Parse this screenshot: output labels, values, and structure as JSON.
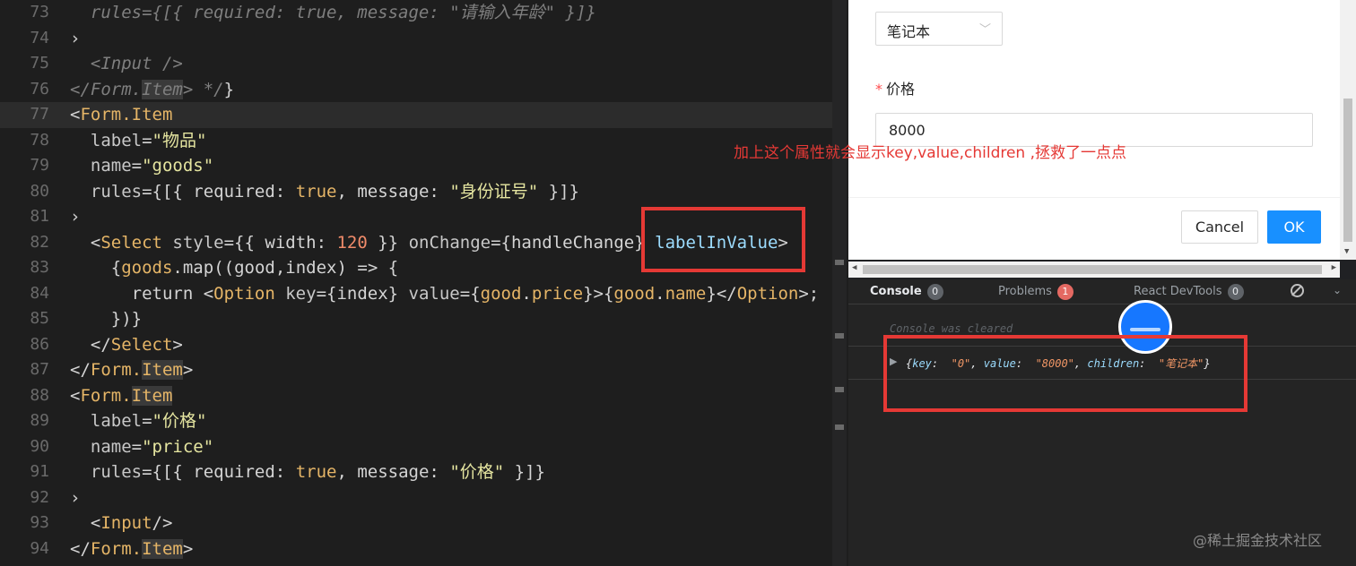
{
  "editor": {
    "lines": [
      {
        "n": "73",
        "segments": [
          [
            "  rules={[{ required: true, message: \"请输入年龄\" }]}",
            "comment"
          ]
        ]
      },
      {
        "n": "74",
        "segments": [
          [
            "›",
            "punct"
          ]
        ]
      },
      {
        "n": "75",
        "segments": [
          [
            "  <Input />",
            "comment"
          ]
        ]
      },
      {
        "n": "76",
        "segments": [
          [
            "</Form.",
            "comment"
          ],
          [
            "Item",
            "comment-hl"
          ],
          [
            "> */",
            "comment"
          ],
          [
            "}",
            "punct"
          ]
        ]
      },
      {
        "n": "77",
        "current": true,
        "segments": [
          [
            "<",
            "punct"
          ],
          [
            "Form.Item",
            "tag"
          ]
        ]
      },
      {
        "n": "78",
        "segments": [
          [
            "  label",
            "attr"
          ],
          [
            "=",
            "punct"
          ],
          [
            "\"物品\"",
            "str"
          ]
        ]
      },
      {
        "n": "79",
        "segments": [
          [
            "  name",
            "attr"
          ],
          [
            "=",
            "punct"
          ],
          [
            "\"goods\"",
            "str"
          ]
        ]
      },
      {
        "n": "80",
        "segments": [
          [
            "  rules",
            "attr"
          ],
          [
            "={[{ ",
            "punct"
          ],
          [
            "required",
            "prop"
          ],
          [
            ": ",
            "punct"
          ],
          [
            "true",
            "kw"
          ],
          [
            ", ",
            "punct"
          ],
          [
            "message",
            "prop"
          ],
          [
            ": ",
            "punct"
          ],
          [
            "\"身份证号\"",
            "str"
          ],
          [
            " }]}",
            "punct"
          ]
        ]
      },
      {
        "n": "81",
        "segments": [
          [
            "›",
            "punct"
          ]
        ]
      },
      {
        "n": "82",
        "segments": [
          [
            "  <",
            "punct"
          ],
          [
            "Select",
            "tag"
          ],
          [
            " style",
            "attr"
          ],
          [
            "={{ ",
            "punct"
          ],
          [
            "width",
            "prop"
          ],
          [
            ": ",
            "punct"
          ],
          [
            "120",
            "num"
          ],
          [
            " }} ",
            "punct"
          ],
          [
            "onChange",
            "attr"
          ],
          [
            "={",
            "punct"
          ],
          [
            "handleChange",
            "fn"
          ],
          [
            "} ",
            "punct"
          ],
          [
            "labelInValue",
            "jsx"
          ],
          [
            ">",
            "punct"
          ]
        ]
      },
      {
        "n": "83",
        "segments": [
          [
            "    {",
            "punct"
          ],
          [
            "goods",
            "var"
          ],
          [
            ".",
            "punct"
          ],
          [
            "map",
            "fn"
          ],
          [
            "((",
            "punct"
          ],
          [
            "good",
            "fn"
          ],
          [
            ",",
            "punct"
          ],
          [
            "index",
            "fn"
          ],
          [
            ") => {",
            "punct"
          ]
        ]
      },
      {
        "n": "84",
        "segments": [
          [
            "      return <",
            "punct"
          ],
          [
            "Option",
            "tag"
          ],
          [
            " key",
            "attr"
          ],
          [
            "={",
            "punct"
          ],
          [
            "index",
            "fn"
          ],
          [
            "} ",
            "punct"
          ],
          [
            "value",
            "attr"
          ],
          [
            "={",
            "punct"
          ],
          [
            "good",
            "var"
          ],
          [
            ".",
            "punct"
          ],
          [
            "price",
            "var"
          ],
          [
            "}>{",
            "punct"
          ],
          [
            "good",
            "var"
          ],
          [
            ".",
            "punct"
          ],
          [
            "name",
            "var"
          ],
          [
            "}</",
            "punct"
          ],
          [
            "Option",
            "tag"
          ],
          [
            ">;",
            "punct"
          ]
        ]
      },
      {
        "n": "85",
        "segments": [
          [
            "    })}",
            "punct"
          ]
        ]
      },
      {
        "n": "86",
        "segments": [
          [
            "  </",
            "punct"
          ],
          [
            "Select",
            "tag"
          ],
          [
            ">",
            "punct"
          ]
        ]
      },
      {
        "n": "87",
        "segments": [
          [
            "</",
            "punct"
          ],
          [
            "Form.",
            "tag"
          ],
          [
            "Item",
            "tag-hl"
          ],
          [
            ">",
            "punct"
          ]
        ]
      },
      {
        "n": "88",
        "segments": [
          [
            "<",
            "punct"
          ],
          [
            "Form.",
            "tag"
          ],
          [
            "Item",
            "tag-hl"
          ]
        ]
      },
      {
        "n": "89",
        "segments": [
          [
            "  label",
            "attr"
          ],
          [
            "=",
            "punct"
          ],
          [
            "\"价格\"",
            "str"
          ]
        ]
      },
      {
        "n": "90",
        "segments": [
          [
            "  name",
            "attr"
          ],
          [
            "=",
            "punct"
          ],
          [
            "\"price\"",
            "str"
          ]
        ]
      },
      {
        "n": "91",
        "segments": [
          [
            "  rules",
            "attr"
          ],
          [
            "={[{ ",
            "punct"
          ],
          [
            "required",
            "prop"
          ],
          [
            ": ",
            "punct"
          ],
          [
            "true",
            "kw"
          ],
          [
            ", ",
            "punct"
          ],
          [
            "message",
            "prop"
          ],
          [
            ": ",
            "punct"
          ],
          [
            "\"价格\"",
            "str"
          ],
          [
            " }]}",
            "punct"
          ]
        ]
      },
      {
        "n": "92",
        "segments": [
          [
            "›",
            "punct"
          ]
        ]
      },
      {
        "n": "93",
        "segments": [
          [
            "  <",
            "punct"
          ],
          [
            "Input",
            "tag"
          ],
          [
            "/>",
            "punct"
          ]
        ]
      },
      {
        "n": "94",
        "segments": [
          [
            "</",
            "punct"
          ],
          [
            "Form.",
            "tag"
          ],
          [
            "Item",
            "tag-hl"
          ],
          [
            ">",
            "punct"
          ]
        ]
      }
    ]
  },
  "modal": {
    "select_value": "笔记本",
    "price_label": "价格",
    "required_mark": "*",
    "price_value": "8000",
    "cancel_label": "Cancel",
    "ok_label": "OK"
  },
  "devtools": {
    "tabs": [
      {
        "label": "Console",
        "count": "0",
        "active": true
      },
      {
        "label": "Problems",
        "count": "1",
        "alert": true
      },
      {
        "label": "React DevTools",
        "count": "0"
      }
    ],
    "cleared_text": "Console was cleared",
    "log": {
      "parts": [
        [
          "{",
          "p"
        ],
        [
          "key",
          "k"
        ],
        [
          ":  ",
          "p"
        ],
        [
          "\"0\"",
          "s"
        ],
        [
          ", ",
          "p"
        ],
        [
          "value",
          "k"
        ],
        [
          ":  ",
          "p"
        ],
        [
          "\"8000\"",
          "s"
        ],
        [
          ", ",
          "p"
        ],
        [
          "children",
          "k"
        ],
        [
          ":  ",
          "p"
        ],
        [
          "\"笔记本\"",
          "s"
        ],
        [
          "}",
          "p"
        ]
      ]
    }
  },
  "annotation": "加上这个属性就会显示key,value,children ,拯救了一点点",
  "watermark": "@稀土掘金技术社区",
  "colors": {
    "annotation_red": "#e53935",
    "primary_blue": "#1890ff"
  }
}
